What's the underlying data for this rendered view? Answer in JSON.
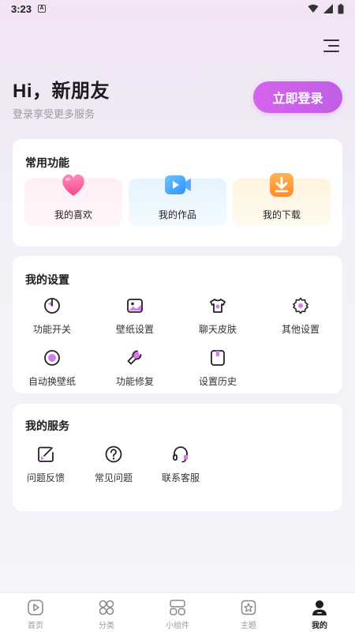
{
  "status_bar": {
    "time": "3:23",
    "notification_glyph": "A"
  },
  "header": {
    "greeting": "Hi，新朋友",
    "subtitle": "登录享受更多服务",
    "login_label": "立即登录"
  },
  "common_functions": {
    "title": "常用功能",
    "items": [
      {
        "label": "我的喜欢",
        "icon": "heart-icon"
      },
      {
        "label": "我的作品",
        "icon": "video-camera-icon"
      },
      {
        "label": "我的下载",
        "icon": "download-icon"
      }
    ]
  },
  "my_settings": {
    "title": "我的设置",
    "items": [
      {
        "label": "功能开关",
        "icon": "power-icon"
      },
      {
        "label": "壁纸设置",
        "icon": "image-icon"
      },
      {
        "label": "聊天皮肤",
        "icon": "shirt-icon"
      },
      {
        "label": "其他设置",
        "icon": "gear-icon"
      },
      {
        "label": "自动换壁纸",
        "icon": "auto-wallpaper-icon"
      },
      {
        "label": "功能修复",
        "icon": "wrench-icon"
      },
      {
        "label": "设置历史",
        "icon": "history-icon"
      }
    ]
  },
  "my_services": {
    "title": "我的服务",
    "items": [
      {
        "label": "问题反馈",
        "icon": "feedback-icon"
      },
      {
        "label": "常见问题",
        "icon": "question-icon"
      },
      {
        "label": "联系客服",
        "icon": "headset-icon"
      }
    ]
  },
  "tabbar": {
    "tabs": [
      {
        "label": "首页",
        "icon": "play-icon"
      },
      {
        "label": "分类",
        "icon": "grid-icon"
      },
      {
        "label": "小组件",
        "icon": "widget-icon"
      },
      {
        "label": "主题",
        "icon": "theme-icon"
      },
      {
        "label": "我的",
        "icon": "profile-icon",
        "active": true
      }
    ]
  },
  "colors": {
    "accent": "#cf62ea",
    "accent_light": "#d978f0"
  }
}
